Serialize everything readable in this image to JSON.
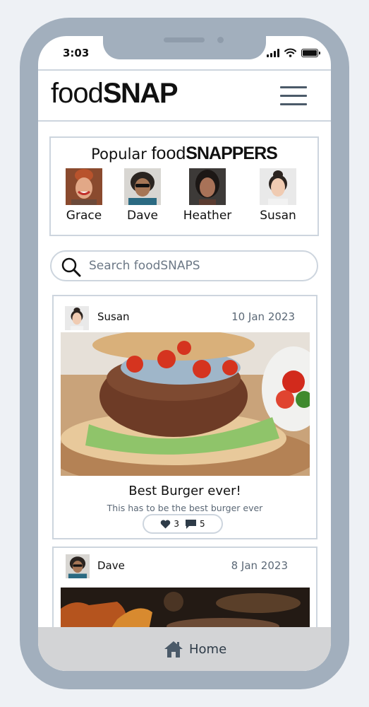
{
  "status_bar": {
    "time": "3:03"
  },
  "header": {
    "logo_light": "food",
    "logo_bold": "SNAP"
  },
  "popular": {
    "title_prefix": "Popular",
    "title_brand_light": "food",
    "title_brand_bold": "SNAPPERS",
    "snappers": [
      {
        "name": "Grace"
      },
      {
        "name": "Dave"
      },
      {
        "name": "Heather"
      },
      {
        "name": "Susan"
      }
    ]
  },
  "search": {
    "placeholder": "Search foodSNAPS"
  },
  "posts": [
    {
      "author": "Susan",
      "date": "10 Jan 2023",
      "title": "Best Burger ever!",
      "description": "This has to be the best burger ever",
      "likes": "3",
      "comments": "5"
    },
    {
      "author": "Dave",
      "date": "8 Jan 2023"
    }
  ],
  "tab_bar": {
    "home_label": "Home"
  },
  "colors": {
    "frame": "#a2afbd",
    "border": "#cdd5de",
    "tab_bar": "#d3d4d6",
    "icon": "#4b5a69"
  },
  "icons": [
    "menu-icon",
    "search-icon",
    "heart-icon",
    "comment-icon",
    "home-icon",
    "signal-icon",
    "wifi-icon",
    "battery-icon"
  ]
}
